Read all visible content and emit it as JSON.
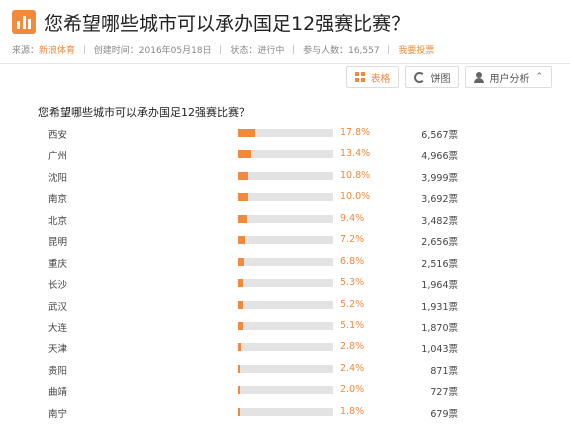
{
  "header": {
    "title": "您希望哪些城市可以承办国足12强赛比赛？",
    "source_label": "来源：",
    "source": "新浪体育",
    "created": "创建时间：2016年05月18日",
    "status": "状态：进行中",
    "participants": "参与人数：16,557",
    "vote_link": "我要投票"
  },
  "toolbar": {
    "table_label": "表格",
    "pie_label": "饼图",
    "user_analysis_label": "用户分析",
    "chevron": "⌃"
  },
  "question": "您希望哪些城市可以承办国足12强赛比赛？",
  "chart_data": {
    "type": "bar",
    "categories": [
      "西安",
      "广州",
      "沈阳",
      "南京",
      "北京",
      "昆明",
      "重庆",
      "长沙",
      "武汉",
      "大连",
      "天津",
      "贵阳",
      "曲靖",
      "南宁"
    ],
    "values": [
      17.8,
      13.4,
      10.8,
      10.0,
      9.4,
      7.2,
      6.8,
      5.3,
      5.2,
      5.1,
      2.8,
      2.4,
      2.0,
      1.8
    ],
    "percent_labels": [
      "17.8%",
      "13.4%",
      "10.8%",
      "10.0%",
      "9.4%",
      "7.2%",
      "6.8%",
      "5.3%",
      "5.2%",
      "5.1%",
      "2.8%",
      "2.4%",
      "2.0%",
      "1.8%"
    ],
    "votes": [
      "6,567票",
      "4,966票",
      "3,999票",
      "3,692票",
      "3,482票",
      "2,656票",
      "2,516票",
      "1,964票",
      "1,931票",
      "1,870票",
      "1,043票",
      "871票",
      "727票",
      "679票"
    ],
    "xlim": [
      0,
      100
    ],
    "bar_color": "#f08a3c",
    "track_color": "#e3e3e3"
  },
  "colors": {
    "accent": "#f08a3c"
  }
}
